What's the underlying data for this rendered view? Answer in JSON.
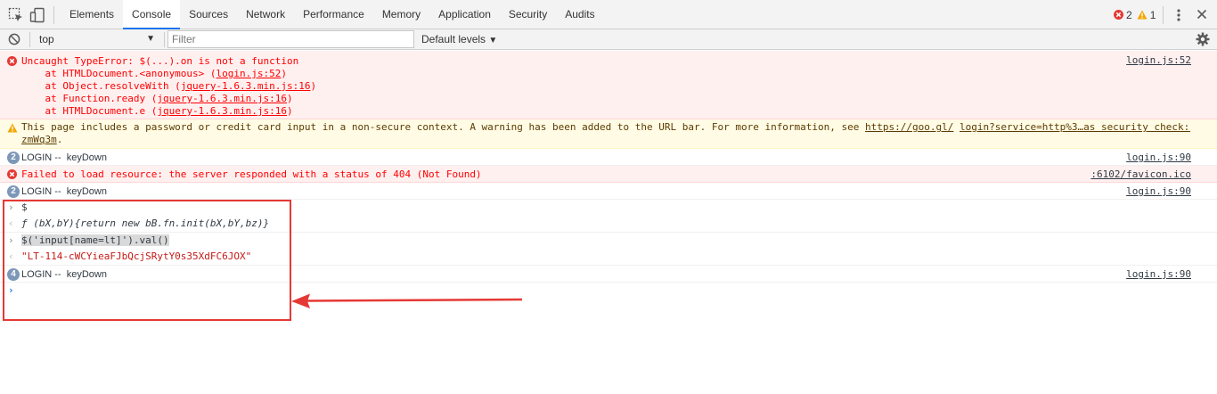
{
  "toolbar": {
    "tabs": [
      {
        "label": "Elements"
      },
      {
        "label": "Console",
        "active": true
      },
      {
        "label": "Sources"
      },
      {
        "label": "Network"
      },
      {
        "label": "Performance"
      },
      {
        "label": "Memory"
      },
      {
        "label": "Application"
      },
      {
        "label": "Security"
      },
      {
        "label": "Audits"
      }
    ],
    "error_count": "2",
    "warning_count": "1",
    "icons": [
      "inspect-icon",
      "device-toggle-icon",
      "kebab-menu-icon",
      "close-icon"
    ]
  },
  "filterbar": {
    "context": "top",
    "filter_placeholder": "Filter",
    "levels": "Default levels"
  },
  "console": {
    "error1": {
      "message": "Uncaught TypeError: $(...).on is not a function",
      "stack": [
        {
          "prefix": "    at HTMLDocument.<anonymous> (",
          "link": "login.js:52",
          "suffix": ")"
        },
        {
          "prefix": "    at Object.resolveWith (",
          "link": "jquery-1.6.3.min.js:16",
          "suffix": ")"
        },
        {
          "prefix": "    at Function.ready (",
          "link": "jquery-1.6.3.min.js:16",
          "suffix": ")"
        },
        {
          "prefix": "    at HTMLDocument.e (",
          "link": "jquery-1.6.3.min.js:16",
          "suffix": ")"
        }
      ],
      "source": "login.js:52"
    },
    "warning": {
      "message": "This page includes a password or credit card input in a non-secure context. A warning has been added to the URL bar. For more information, see ",
      "link1": "https://goo.gl/",
      "link2": "login?service=http%3…as security check:1",
      "continuation": "zmWq3m",
      "continuation_suffix": "."
    },
    "log1": {
      "count": "2",
      "text": "LOGIN --  keyDown",
      "source": "login.js:90"
    },
    "error2": {
      "message": "Failed to load resource: the server responded with a status of 404 (Not Found)",
      "source": ":6102/favicon.ico"
    },
    "log2": {
      "count": "2",
      "text": "LOGIN --  keyDown",
      "source": "login.js:90"
    },
    "input1": "$",
    "result1": "ƒ (bX,bY){return new bB.fn.init(bX,bY,bz)}",
    "input2": "$('input[name=lt]').val()",
    "result2": "\"LT-114-cWCYieaFJbQcjSRytY0s35XdFC6JOX\"",
    "log3": {
      "count": "4",
      "text": "LOGIN --  keyDown",
      "source": "login.js:90"
    },
    "prompt": ""
  },
  "colors": {
    "error_bg": "#fff0f0",
    "error_text": "#ff0000",
    "warning_bg": "#fffbe5",
    "badge": "#7c97b8",
    "annotation": "#e53935",
    "active_tab_underline": "#1a73e8"
  }
}
